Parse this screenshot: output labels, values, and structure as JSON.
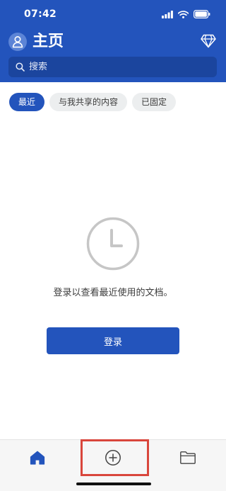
{
  "status": {
    "time": "07:42"
  },
  "header": {
    "title": "主页"
  },
  "search": {
    "placeholder": "搜索"
  },
  "tabs": [
    {
      "label": "最近",
      "active": true
    },
    {
      "label": "与我共享的内容",
      "active": false
    },
    {
      "label": "已固定",
      "active": false
    }
  ],
  "empty_state": {
    "message": "登录以查看最近使用的文档。",
    "login_label": "登录"
  },
  "bottom_nav": {
    "items": [
      {
        "icon": "home-icon",
        "selected": true
      },
      {
        "icon": "add-icon",
        "selected": false,
        "highlighted": true
      },
      {
        "icon": "folder-icon",
        "selected": false
      }
    ]
  },
  "colors": {
    "brand": "#2354bc",
    "search_bg": "#1b459e",
    "highlight": "#d9463c",
    "nav_bg": "#f6f6f6"
  }
}
